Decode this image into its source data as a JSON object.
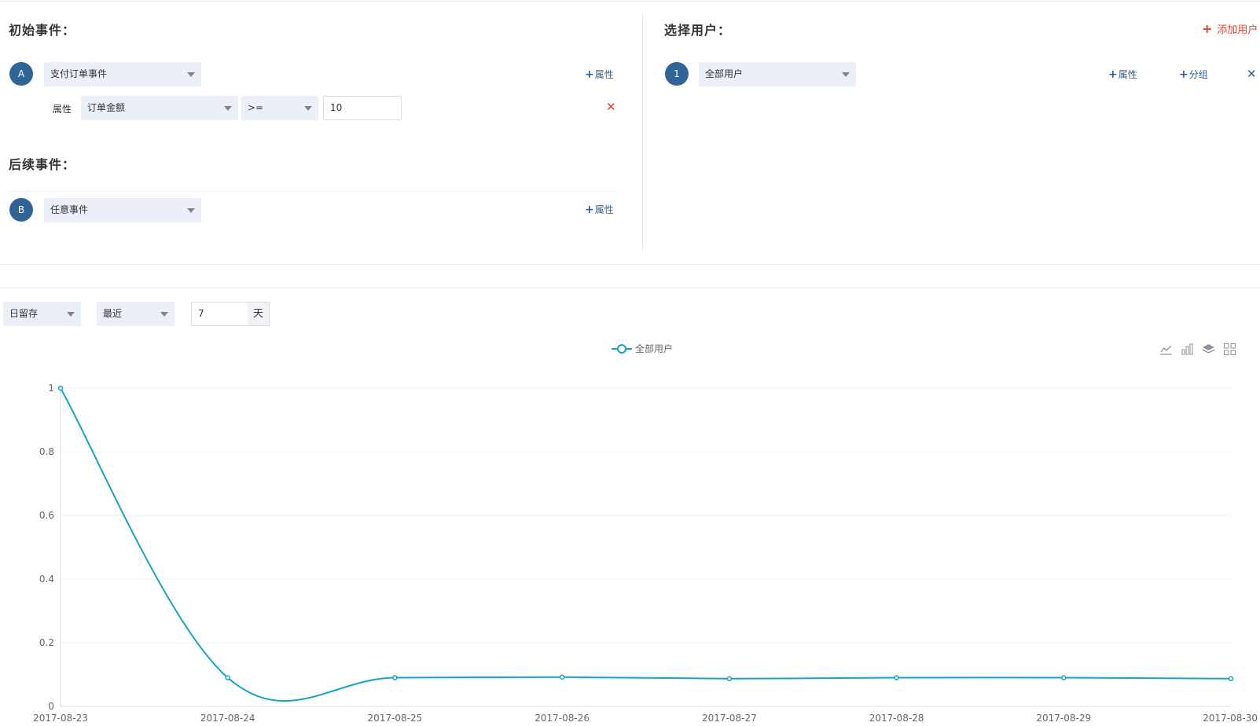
{
  "initial_event": {
    "title": "初始事件：",
    "badge": "A",
    "event_select": "支付订单事件",
    "add_property": "属性",
    "filter": {
      "label": "属性",
      "property_select": "订单金额",
      "operator_select": ">=",
      "value": "10"
    }
  },
  "followup_event": {
    "title": "后续事件：",
    "badge": "B",
    "event_select": "任意事件",
    "add_property": "属性"
  },
  "user_select": {
    "title": "选择用户：",
    "add_user": "添加用户",
    "badge": "1",
    "user_select": "全部用户",
    "add_property": "属性",
    "add_group": "分组"
  },
  "controls": {
    "retention_type": "日留存",
    "range_type": "最近",
    "days_value": "7",
    "days_unit": "天"
  },
  "colors": {
    "primary": "#2f6596",
    "line": "#19a3c4",
    "danger": "#e0432e"
  },
  "chart_data": {
    "type": "line",
    "legend_position": "top-center",
    "grid": true,
    "x": [
      "2017-08-23",
      "2017-08-24",
      "2017-08-25",
      "2017-08-26",
      "2017-08-27",
      "2017-08-28",
      "2017-08-29",
      "2017-08-30"
    ],
    "series": [
      {
        "name": "全部用户",
        "values": [
          1,
          0.09,
          0.09,
          0.092,
          0.087,
          0.09,
          0.09,
          0.087
        ]
      }
    ],
    "ylim": [
      0,
      1
    ],
    "y_ticks": [
      "0",
      "0.2",
      "0.4",
      "0.6",
      "0.8",
      "1"
    ]
  }
}
